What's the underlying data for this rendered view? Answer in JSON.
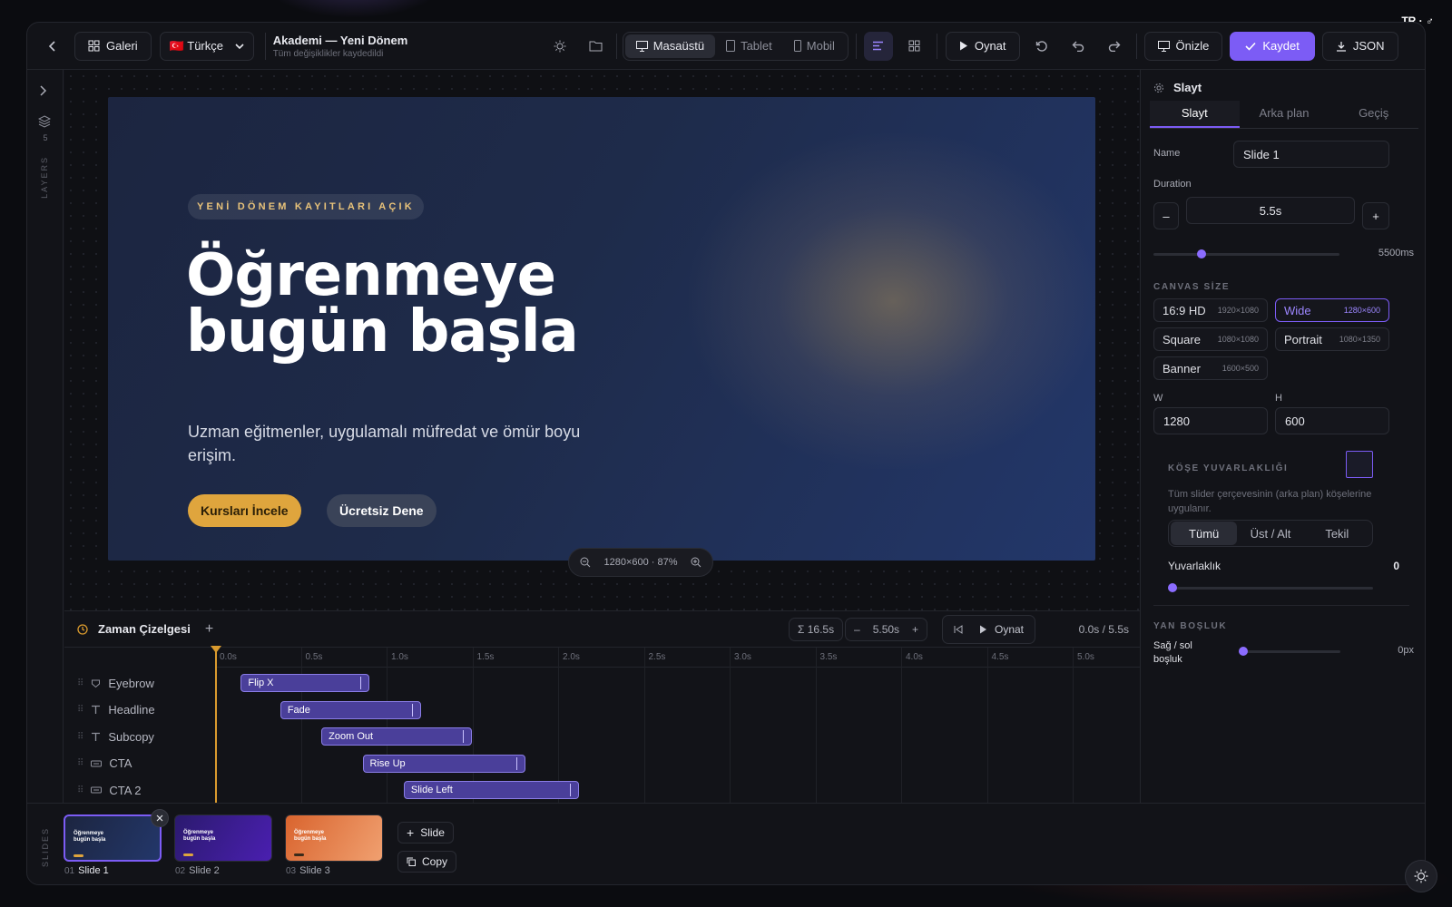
{
  "corner_badge": "TR · ♂",
  "topbar": {
    "gallery_label": "Galeri",
    "language": "🇹🇷 Türkçe",
    "project_title": "Akademi — Yeni Dönem",
    "project_status": "Tüm değişiklikler kaydedildi",
    "device_tabs": [
      "Masaüstü",
      "Tablet",
      "Mobil"
    ],
    "active_device": "Masaüstü",
    "play_label": "Oynat",
    "preview_label": "Önizle",
    "save_label": "Kaydet",
    "json_label": "JSON",
    "accent_color": "#7c5cf5"
  },
  "rail": {
    "layers_count": "5",
    "layers_label": "LAYERS"
  },
  "slide": {
    "eyebrow": "YENİ DÖNEM KAYITLARI AÇIK",
    "headline": "Öğrenmeye bugün başla",
    "subcopy": "Uzman eğitmenler, uygulamalı müfredat ve ömür boyu erişim.",
    "cta_primary": "Kursları İncele",
    "cta_secondary": "Ücretsiz Dene",
    "zoom_readout": "1280×600 · 87%"
  },
  "timeline": {
    "title": "Zaman Çizelgesi",
    "total": "Σ 16.5s",
    "duration": "5.50s",
    "play_label": "Oynat",
    "time_readout": "0.0s / 5.5s",
    "ticks": [
      "0.0s",
      "0.5s",
      "1.0s",
      "1.5s",
      "2.0s",
      "2.5s",
      "3.0s",
      "3.5s",
      "4.0s",
      "4.5s",
      "5.0s"
    ],
    "tracks": [
      {
        "label": "Eyebrow",
        "icon": "badge-icon",
        "clip": "Flip X",
        "start": 0.15,
        "end": 0.9
      },
      {
        "label": "Headline",
        "icon": "text-icon",
        "clip": "Fade",
        "start": 0.38,
        "end": 1.2
      },
      {
        "label": "Subcopy",
        "icon": "text-icon",
        "clip": "Zoom Out",
        "start": 0.62,
        "end": 1.5
      },
      {
        "label": "CTA",
        "icon": "button-icon",
        "clip": "Rise Up",
        "start": 0.86,
        "end": 1.81
      },
      {
        "label": "CTA 2",
        "icon": "button-icon",
        "clip": "Slide Left",
        "start": 1.1,
        "end": 2.12
      }
    ]
  },
  "panel": {
    "title": "Slayt",
    "tabs": [
      "Slayt",
      "Arka plan",
      "Geçiş"
    ],
    "name_label": "Name",
    "name_value": "Slide 1",
    "duration_label": "Duration",
    "duration_value": "5.5s",
    "duration_ms": "5500ms",
    "canvas_size_title": "CANVAS SİZE",
    "sizes": [
      {
        "name": "16:9 HD",
        "dims": "1920×1080"
      },
      {
        "name": "Wide",
        "dims": "1280×600"
      },
      {
        "name": "Square",
        "dims": "1080×1080"
      },
      {
        "name": "Portrait",
        "dims": "1080×1350"
      },
      {
        "name": "Banner",
        "dims": "1600×500"
      }
    ],
    "active_size": "Wide",
    "w_label": "W",
    "w_value": "1280",
    "h_label": "H",
    "h_value": "600",
    "corner_title": "KÖŞE YUVARLAKLIĞI",
    "corner_desc": "Tüm slider çerçevesinin (arka plan) köşelerine uygulanır.",
    "corner_modes": [
      "Tümü",
      "Üst / Alt",
      "Tekil"
    ],
    "roundness_label": "Yuvarlaklık",
    "roundness_value": "0",
    "side_title": "YAN BOŞLUK",
    "side_label": "Sağ / sol boşluk",
    "side_value": "0px"
  },
  "slides_strip": {
    "label": "SLIDES",
    "slides": [
      {
        "num": "01",
        "name": "Slide 1"
      },
      {
        "num": "02",
        "name": "Slide 2"
      },
      {
        "num": "03",
        "name": "Slide 3"
      }
    ],
    "thumb_text": "Öğrenmeye bugün başla",
    "add_label": "Slide",
    "copy_label": "Copy"
  }
}
